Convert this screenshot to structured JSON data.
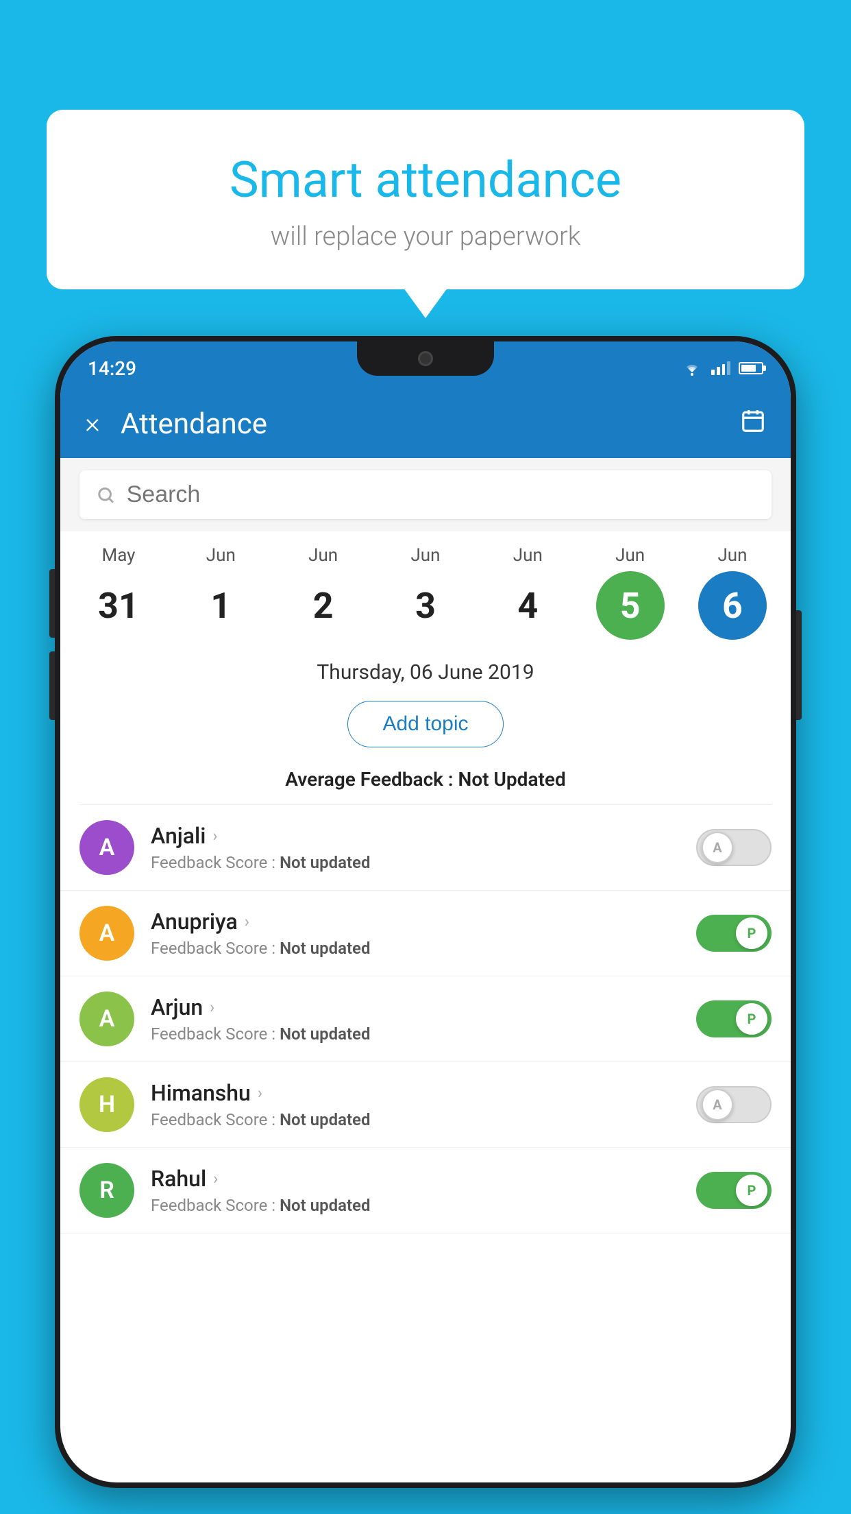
{
  "background_color": "#1ab8e8",
  "speech_bubble": {
    "title": "Smart attendance",
    "subtitle": "will replace your paperwork"
  },
  "status_bar": {
    "time": "14:29"
  },
  "app_header": {
    "title": "Attendance",
    "close_label": "×",
    "calendar_label": "📅"
  },
  "search": {
    "placeholder": "Search"
  },
  "calendar": {
    "days": [
      {
        "month": "May",
        "date": "31",
        "state": "normal"
      },
      {
        "month": "Jun",
        "date": "1",
        "state": "normal"
      },
      {
        "month": "Jun",
        "date": "2",
        "state": "normal"
      },
      {
        "month": "Jun",
        "date": "3",
        "state": "normal"
      },
      {
        "month": "Jun",
        "date": "4",
        "state": "normal"
      },
      {
        "month": "Jun",
        "date": "5",
        "state": "today"
      },
      {
        "month": "Jun",
        "date": "6",
        "state": "selected"
      }
    ]
  },
  "selected_date_label": "Thursday, 06 June 2019",
  "add_topic_label": "Add topic",
  "average_feedback": {
    "label": "Average Feedback : ",
    "value": "Not Updated"
  },
  "students": [
    {
      "name": "Anjali",
      "avatar_letter": "A",
      "avatar_color": "#9c4dcc",
      "feedback_label": "Feedback Score : ",
      "feedback_value": "Not updated",
      "attendance": "absent"
    },
    {
      "name": "Anupriya",
      "avatar_letter": "A",
      "avatar_color": "#f5a623",
      "feedback_label": "Feedback Score : ",
      "feedback_value": "Not updated",
      "attendance": "present"
    },
    {
      "name": "Arjun",
      "avatar_letter": "A",
      "avatar_color": "#8bc34a",
      "feedback_label": "Feedback Score : ",
      "feedback_value": "Not updated",
      "attendance": "present"
    },
    {
      "name": "Himanshu",
      "avatar_letter": "H",
      "avatar_color": "#b2c840",
      "feedback_label": "Feedback Score : ",
      "feedback_value": "Not updated",
      "attendance": "absent"
    },
    {
      "name": "Rahul",
      "avatar_letter": "R",
      "avatar_color": "#4caf50",
      "feedback_label": "Feedback Score : ",
      "feedback_value": "Not updated",
      "attendance": "present"
    }
  ]
}
